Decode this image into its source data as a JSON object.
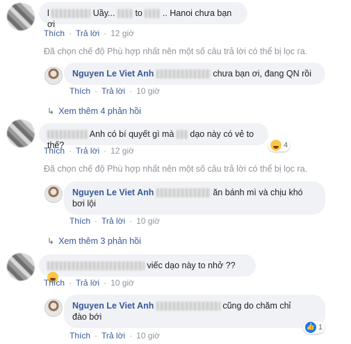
{
  "labels": {
    "like": "Thích",
    "reply": "Trả lời",
    "sep": "·",
    "filtered_notice": "Đã chọn chế độ Phù hợp nhất nên một số câu trả lời có thể bị lọc ra."
  },
  "comments": [
    {
      "text_pre": "l",
      "text_mid1": "Uầy...",
      "text_mid2": "to",
      "text_post": ".. Hanoi chưa bạn ơi",
      "time": "12 giờ",
      "reply": {
        "author": "Nguyen Le Viet Anh",
        "text": "chưa bạn ơi, đang QN rồi",
        "time": "10 giờ"
      },
      "more": "Xem thêm 4 phản hồi"
    },
    {
      "text": "Anh có bí quyết gì mà",
      "text_post": "dạo này có vẻ to thế?",
      "time": "12 giờ",
      "reaction_count": "4",
      "reply": {
        "author": "Nguyen Le Viet Anh",
        "text_line1": "ăn bánh mì và chịu khó",
        "text_line2": "bơi lội",
        "time": "10 giờ"
      },
      "more": "Xem thêm 3 phản hồi"
    },
    {
      "text": "viếc dạo này to nhở ??",
      "time": "10 giờ",
      "reply": {
        "author": "Nguyen Le Viet Anh",
        "text_line1": "cũng do chăm chỉ",
        "text_line2": "đào bới",
        "time": "10 giờ",
        "reaction_count": "1"
      }
    }
  ]
}
